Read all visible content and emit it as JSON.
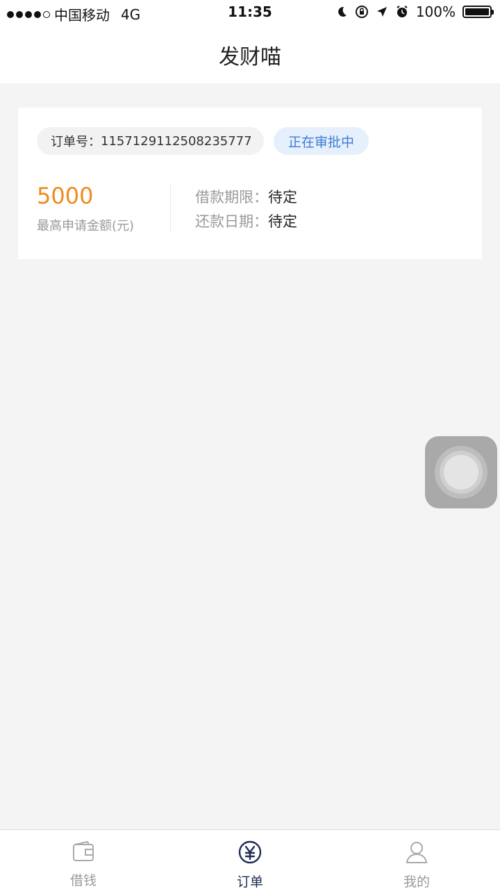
{
  "status_bar": {
    "carrier": "中国移动",
    "network": "4G",
    "time": "11:35",
    "battery": "100%"
  },
  "nav": {
    "title": "发财喵"
  },
  "order_card": {
    "order_label": "订单号：",
    "order_number": "1157129112508235777",
    "status": "正在审批中",
    "amount": "5000",
    "amount_label": "最高申请金额(元)",
    "loan_term_label": "借款期限：",
    "loan_term_value": "待定",
    "repay_date_label": "还款日期：",
    "repay_date_value": "待定"
  },
  "tabbar": {
    "tabs": [
      {
        "label": "借钱",
        "icon": "wallet-icon",
        "active": false
      },
      {
        "label": "订单",
        "icon": "yen-icon",
        "active": true
      },
      {
        "label": "我的",
        "icon": "user-icon",
        "active": false
      }
    ]
  },
  "colors": {
    "accent_orange": "#f08a1c",
    "status_blue": "#3a7bd5",
    "tab_active": "#1f2a55",
    "tab_inactive": "#999999"
  }
}
